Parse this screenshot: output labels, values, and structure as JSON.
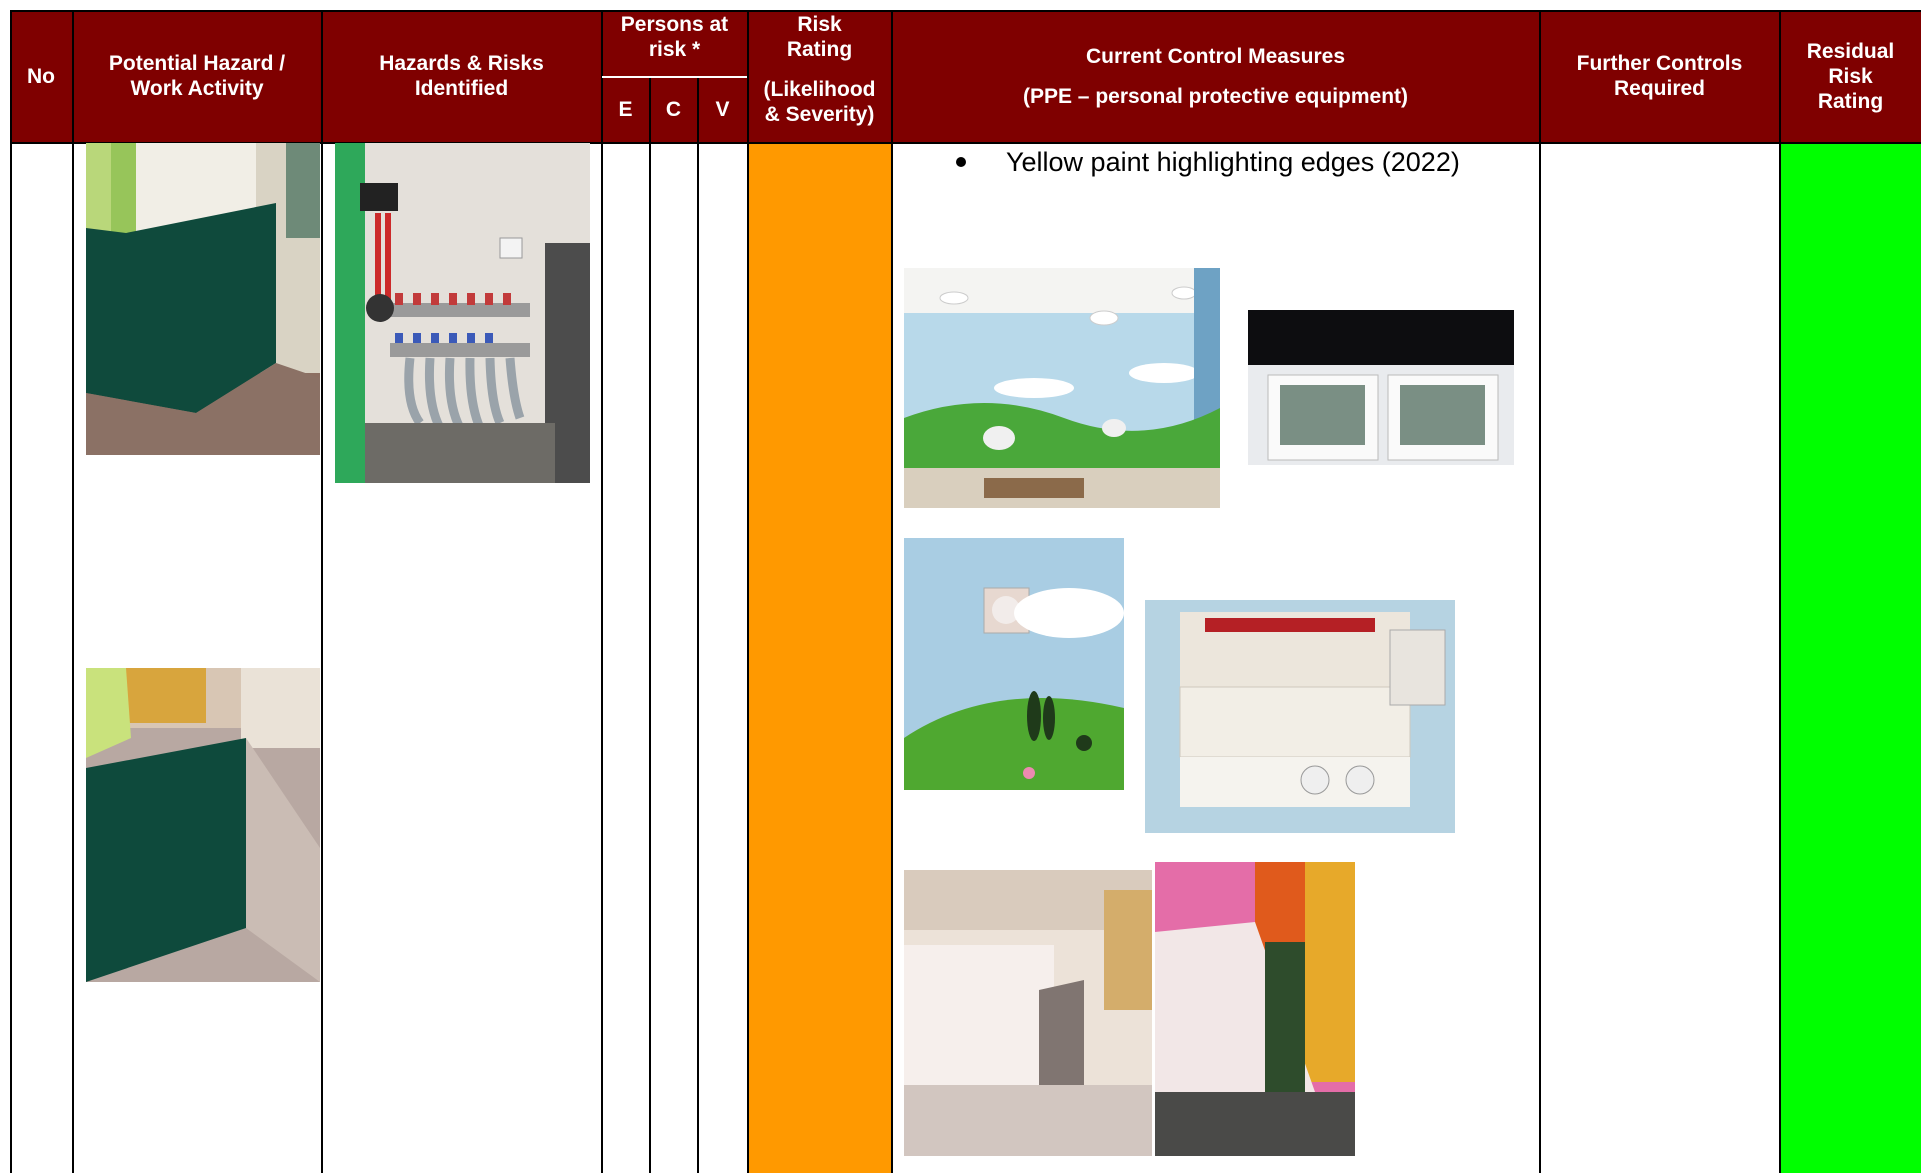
{
  "header": {
    "no": "No",
    "hazard_line1": "Potential Hazard /",
    "hazard_line2": "Work Activity",
    "risks_line1": "Hazards & Risks",
    "risks_line2": "Identified",
    "persons_line1": "Persons at",
    "persons_line2": "risk *",
    "persons_e": "E",
    "persons_c": "C",
    "persons_v": "V",
    "rating_line1": "Risk",
    "rating_line2": "Rating",
    "rating_line3": "(Likelihood",
    "rating_line4": "& Severity)",
    "controls_line1": "Current Control Measures",
    "controls_line2": "(PPE – personal protective equipment)",
    "further_line1": "Further Controls",
    "further_line2": "Required",
    "residual_line1": "Residual",
    "residual_line2": "Risk",
    "residual_line3": "Rating"
  },
  "row": {
    "control_bullet": "Yellow paint highlighting edges (2022)",
    "risk_rating_color": "#ff9900",
    "residual_rating_color": "#00ff00"
  },
  "colors": {
    "header_bg": "#7f0000",
    "header_text": "#ffffff"
  }
}
